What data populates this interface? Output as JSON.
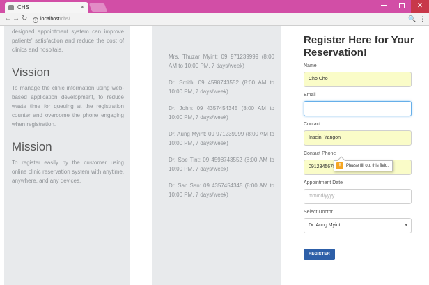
{
  "browser": {
    "tab_title": "CHS",
    "tab_close": "×",
    "url_host": "localhost",
    "url_path": "/chs/",
    "menu_icon": "⋮",
    "zoom_icon": "🔍"
  },
  "col1": {
    "intro_tail": "designed appointment system can improve patients' satisfaction and reduce the cost of clinics and hospitals.",
    "vision_title": "Vission",
    "vision_text": "To manage the clinic information using web-based application development, to reduce waste time for queuing at the registration counter and overcome the phone engaging when registration.",
    "mission_title": "Mission",
    "mission_text": "To register easily by the customer using online clinic reservation system with anytime, anywhere, and any devices."
  },
  "doctors": [
    "Mrs. Thuzar Myint: 09 971239999 (8:00 AM to 10:00 PM, 7 days/week)",
    "Dr. Smith: 09 4598743552 (8:00 AM to 10:00 PM, 7 days/week)",
    "Dr. John: 09 4357454345 (8:00 AM to 10:00 PM, 7 days/week)",
    "Dr. Aung Myint: 09 971239999 (8:00 AM to 10:00 PM, 7 days/week)",
    "Dr. Soe Tint: 09 4598743552 (8:00 AM to 10:00 PM, 7 days/week)",
    "Dr. San San: 09 4357454345 (8:00 AM to 10:00 PM, 7 days/week)"
  ],
  "form": {
    "title": "Register Here for Your Reservation!",
    "name_label": "Name",
    "name_value": "Cho Cho",
    "email_label": "Email",
    "email_value": "",
    "address_label": "Contact",
    "address_value": "Insein, Yangon",
    "phone_label": "Contact Phone",
    "phone_value": "0912345678",
    "date_label": "Appointment Date",
    "date_placeholder": "mm/dd/yyyy",
    "doctor_label": "Select Doctor",
    "doctor_value": "Dr. Aung Myint",
    "register_label": "REGISTER",
    "tooltip_text": "Please fill out this field."
  },
  "colors": {
    "chrome_accent": "#d24ea6",
    "autofill_bg": "#fafcc8",
    "button": "#2d5fa8"
  }
}
